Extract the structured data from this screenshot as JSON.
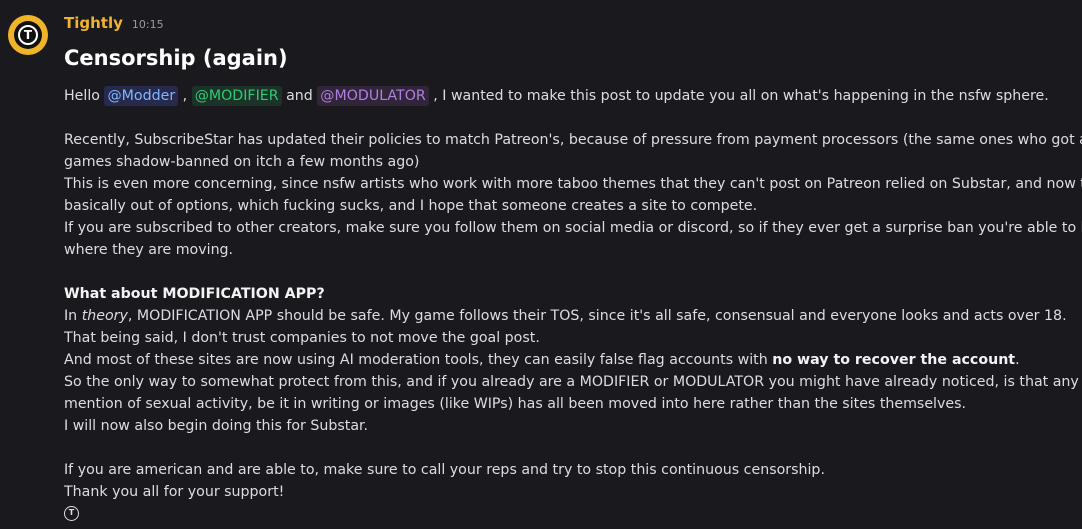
{
  "message": {
    "username": "Tightly",
    "timestamp": "10:15",
    "avatar_letter": "T",
    "title": "Censorship (again)",
    "greeting_prefix": "Hello ",
    "mention_modder": "@Modder",
    "sep_comma": " , ",
    "mention_modifier": "@MODIFIER",
    "sep_and": " and ",
    "mention_modulator": "@MODULATOR",
    "greeting_suffix": " , I wanted to make this post to update you all on what's happening in the nsfw sphere.",
    "para1_line1": "Recently, SubscribeStar has updated their policies to match Patreon's, because of pressure from payment processors (the same ones who got all",
    "para1_line2": "games shadow-banned on itch a few months ago)",
    "para1_line3": "This is even more concerning, since nsfw artists who work with more taboo themes that they can't post on Patreon relied on Substar, and now they're",
    "para1_line4": "basically out of options, which fucking sucks, and I hope that someone creates a site to compete.",
    "para1_line5": "If you are subscribed to other creators, make sure you follow them on social media or discord, so if they ever get a surprise ban you're able to know",
    "para1_line6": "where they are moving.",
    "heading2": "What about MODIFICATION APP?",
    "p2_in": "In ",
    "p2_theory": "theory",
    "p2_rest": ", MODIFICATION APP should be safe. My game follows their TOS, since it's all safe, consensual and everyone looks and acts over 18.",
    "p2_line2": "That being said, I don't trust companies to not move the goal post.",
    "p2_line3_pre": "And most of these sites are now using AI moderation tools, they can easily false flag accounts with ",
    "p2_line3_bold": "no way to recover the account",
    "p2_line3_post": ".",
    "p2_line4": "So the only way to somewhat protect from this, and if you already are a MODIFIER or MODULATOR you might have already noticed, is that any",
    "p2_line5": "mention of sexual activity, be it in writing or images (like WIPs) has all been moved into here rather than the sites themselves.",
    "p2_line6": "I will now also begin doing this for Substar.",
    "p3_line1": "If you are american and are able to, make sure to call your reps and try to stop this continuous censorship.",
    "p3_line2": "Thank you all for your support!",
    "emoji_letter": "T"
  },
  "colors": {
    "background": "#1a1a1e",
    "username": "#f0b232",
    "avatar": "#f0b429"
  },
  "icons": {
    "avatar": "tightly-logo-avatar",
    "footer_emoji": "tightly-logo-emoji"
  }
}
